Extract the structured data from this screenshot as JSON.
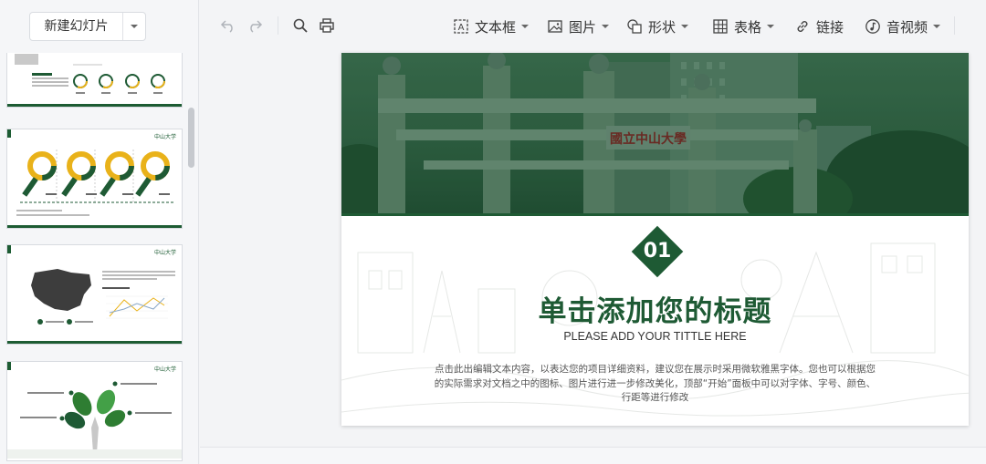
{
  "sidebar": {
    "new_slide_label": "新建幻灯片",
    "thumbnails": [
      {
        "index": 1,
        "kind": "features",
        "cards": [
          "诊断功能模块",
          "",
          ""
        ],
        "labels": [
          "功能描述",
          "功能描述",
          "功能描述",
          "功能描述"
        ]
      },
      {
        "index": 2,
        "kind": "magnifier-rings",
        "labels": [
          "关键词",
          "关键词",
          "关键词",
          "关键词"
        ]
      },
      {
        "index": 3,
        "kind": "map-line"
      },
      {
        "index": 4,
        "kind": "tree"
      }
    ]
  },
  "toolbar": {
    "items": [
      {
        "label": "文本框",
        "icon": "textbox-icon",
        "dropdown": true
      },
      {
        "label": "图片",
        "icon": "image-icon",
        "dropdown": true
      },
      {
        "label": "形状",
        "icon": "shape-icon",
        "dropdown": true
      },
      {
        "label": "表格",
        "icon": "table-icon",
        "dropdown": true
      },
      {
        "label": "链接",
        "icon": "link-icon",
        "dropdown": false
      },
      {
        "label": "音视频",
        "icon": "audio-video-icon",
        "dropdown": true
      }
    ],
    "left_icons": [
      "undo-icon",
      "redo-icon",
      "search-icon",
      "print-icon"
    ]
  },
  "slide": {
    "photo_sign": "國立中山大學",
    "badge_number": "01",
    "title": "单击添加您的标题",
    "subtitle": "PLEASE ADD YOUR TITTLE HERE",
    "body": "点击此出编辑文本内容，以表达您的项目详细资料，建议您在展示时采用微软雅黑字体。您也可以根据您的实际需求对文档之中的图标、图片进行进一步修改美化，顶部“开始”面板中可以对字体、字号、颜色、行距等进行修改"
  },
  "colors": {
    "brand_green": "#1e5a34",
    "accent_yellow": "#e9b21a"
  }
}
